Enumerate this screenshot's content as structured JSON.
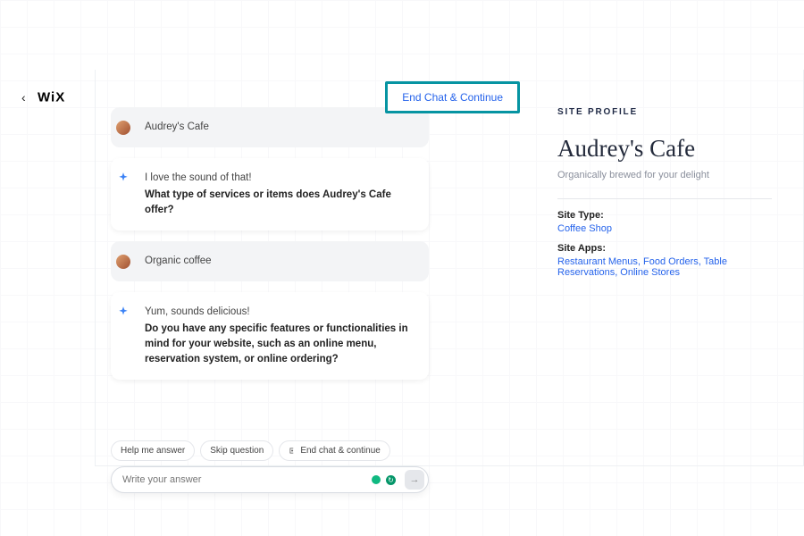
{
  "header": {
    "logo": "WiX",
    "end_chat_label": "End Chat & Continue"
  },
  "chat": {
    "msg1": {
      "author": "Audrey's Cafe"
    },
    "msg2": {
      "intro": "I love the sound of that!",
      "question": "What type of services or items does Audrey's Cafe offer?"
    },
    "msg3": {
      "text": "Organic coffee"
    },
    "msg4": {
      "intro": "Yum, sounds delicious!",
      "question": "Do you have any specific features or functionalities in mind for your website, such as an online menu, reservation system, or online ordering?"
    }
  },
  "chips": {
    "help": "Help me answer",
    "skip": "Skip question",
    "end": "End chat & continue"
  },
  "composer": {
    "placeholder": "Write your answer"
  },
  "profile": {
    "kicker": "SITE PROFILE",
    "title": "Audrey's Cafe",
    "sub": "Organically brewed for your delight",
    "type_label": "Site Type:",
    "type_value": "Coffee Shop",
    "apps_label": "Site Apps:",
    "apps_value": "Restaurant Menus, Food Orders, Table Reservations, Online Stores"
  }
}
